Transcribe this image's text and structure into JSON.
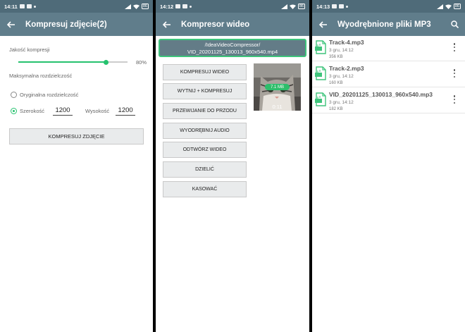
{
  "status_bars": [
    {
      "time": "14:11",
      "battery": "86"
    },
    {
      "time": "14:12",
      "battery": "86"
    },
    {
      "time": "14:13",
      "battery": "86"
    }
  ],
  "compress_image": {
    "title": "Kompresuj zdjęcie(2)",
    "quality_label": "Jakość kompresji",
    "quality_value": 0.8,
    "quality_text": "80%",
    "max_res_label": "Maksymalna rozdzielczość",
    "original_res_label": "Oryginalna rozdzielczość",
    "width_label": "Szerokość",
    "width_value": "1200",
    "height_label": "Wysokość",
    "height_value": "1200",
    "compress_button": "KOMPRESUJ ZDJĘCIE"
  },
  "video_compressor": {
    "title": "Kompresor wideo",
    "path_line1": "/IdeaVideoCompressor/",
    "path_line2": "VID_20201125_130013_960x540.mp4",
    "buttons": [
      "KOMPRESUJ WIDEO",
      "WYTNIJ + KOMPRESUJ",
      "PRZEWIJANIE DO PRZODU",
      "WYODRĘBNIJ AUDIO",
      "ODTWÓRZ WIDEO",
      "DZIELIĆ",
      "KASOWAĆ"
    ],
    "thumb_size": "7.1 MB",
    "thumb_duration": "0:11"
  },
  "mp3_files": {
    "title": "Wyodrębnione pliki MP3",
    "files": [
      {
        "name": "Track-4.mp3",
        "date": "3 gru, 14:12",
        "size": "356 KB"
      },
      {
        "name": "Track-2.mp3",
        "date": "3 gru, 14:12",
        "size": "160 KB"
      },
      {
        "name": "VID_20201125_130013_960x540.mp3",
        "date": "3 gru, 14:12",
        "size": "182 KB"
      }
    ]
  },
  "colors": {
    "app_bar": "#607d8b",
    "status_bar": "#4f6b79",
    "accent": "#25c26e"
  }
}
